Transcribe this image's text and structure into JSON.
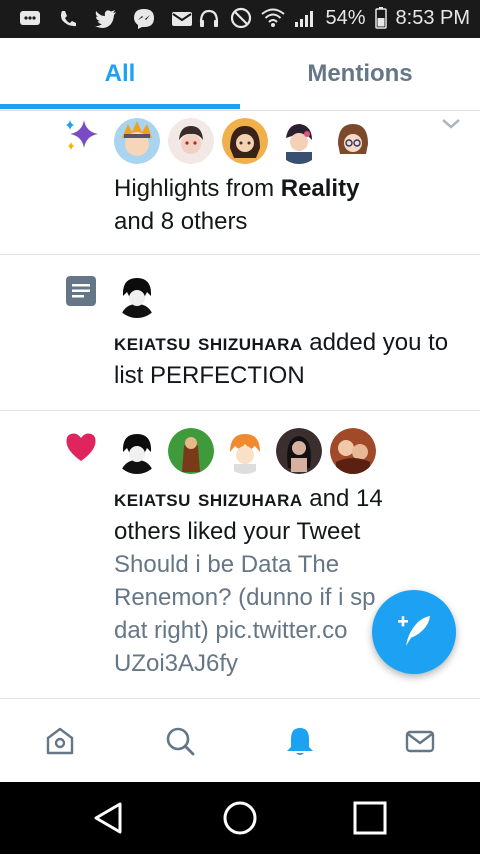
{
  "status_bar": {
    "left_icons": [
      "message-icon",
      "phone-icon",
      "twitter-icon",
      "messenger-icon",
      "mail-icon"
    ],
    "right_icons": [
      "headphones-icon",
      "no-disturb-icon",
      "wifi-icon",
      "signal-icon"
    ],
    "battery": "54%",
    "time": "8:53 PM"
  },
  "tabs": [
    {
      "label": "All",
      "active": true
    },
    {
      "label": "Mentions",
      "active": false
    }
  ],
  "notifications": [
    {
      "type": "highlights",
      "icon": "sparkle-icon",
      "text_plain": "Highlights from ",
      "text_bold": "Reality",
      "text_tail": "and 8 others",
      "avatar_count": 5
    },
    {
      "type": "list",
      "icon": "list-icon",
      "name": "keiatsu shizuhara",
      "text": " added you to list PERFECTION",
      "avatar_count": 1
    },
    {
      "type": "like",
      "icon": "heart-icon",
      "name": "keiatsu shizuhara",
      "text": " and 14 others liked your Tweet",
      "tweet": "Should i be Data The Renemon? (dunno if i spelled dat right) pic.twitter.com/UZoi3AJ6fy",
      "tweet_visible_line1": "Should i be Data The",
      "tweet_visible_line2": "Renemon? (dunno if i sp",
      "tweet_visible_line3": "dat right) pic.twitter.co",
      "tweet_visible_line4": "UZoi3AJ6fy",
      "avatar_count": 5
    }
  ],
  "colors": {
    "accent": "#1da1f2",
    "like": "#e0245e",
    "sparkle": "#794bc4",
    "list": "#657786"
  },
  "bottom_nav": [
    "home-icon",
    "search-icon",
    "notifications-icon",
    "messages-icon"
  ],
  "fab_icon": "compose-icon",
  "system_nav": [
    "back-icon",
    "home-circle-icon",
    "recents-icon"
  ]
}
